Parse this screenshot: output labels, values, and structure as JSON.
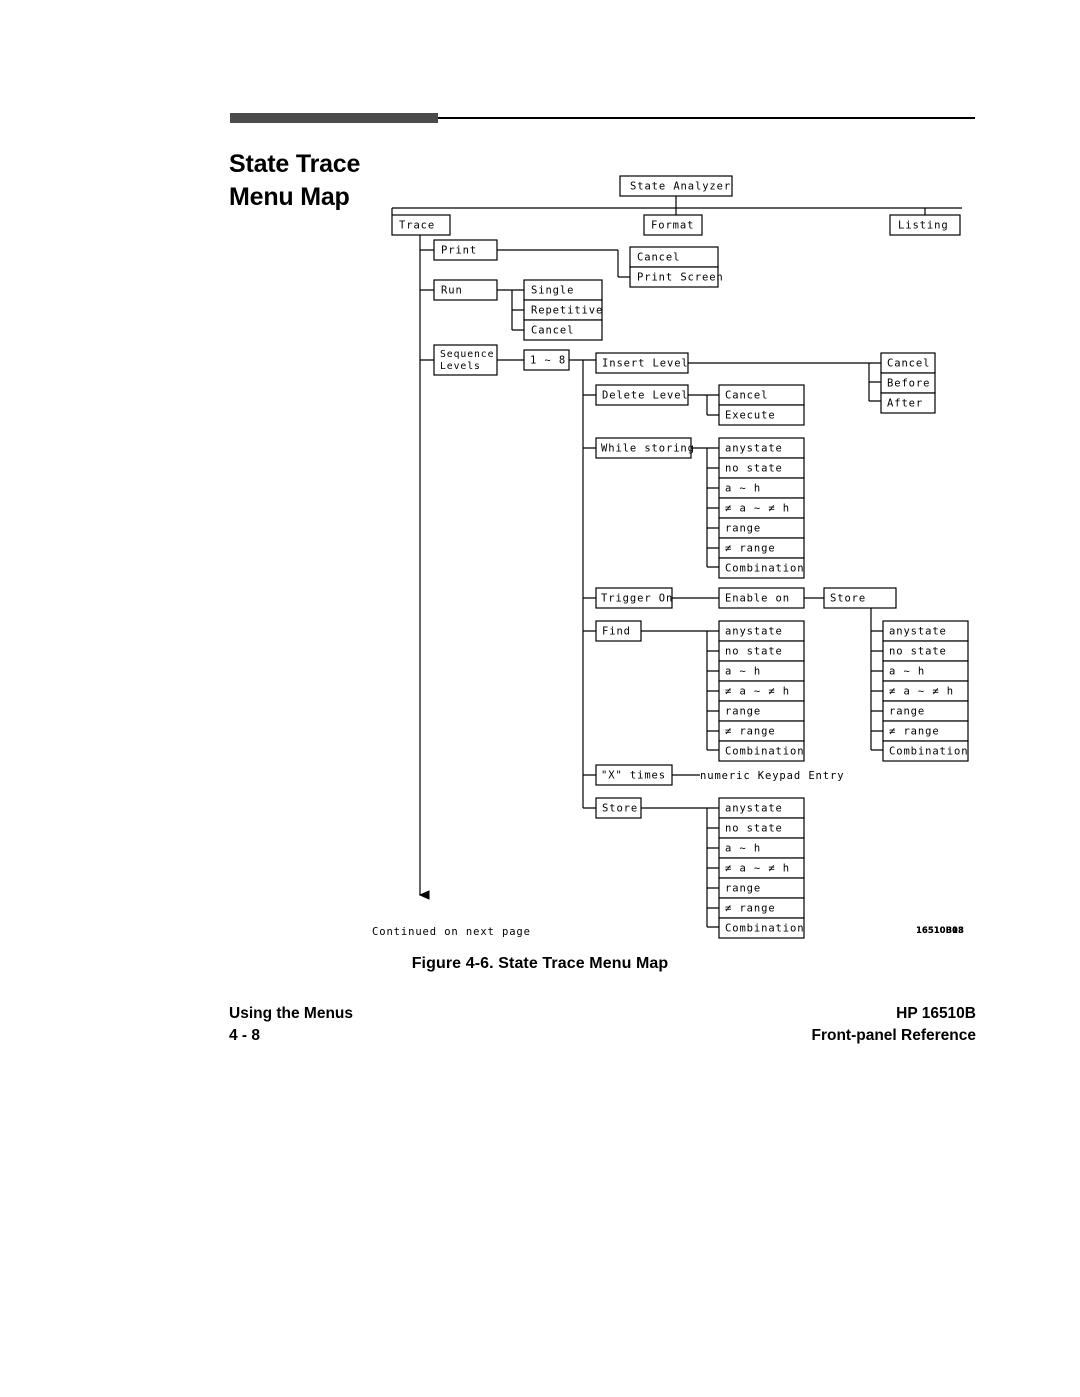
{
  "page": {
    "title_line1": "State Trace",
    "title_line2": "Menu Map",
    "figure_caption": "Figure 4-6. State Trace Menu Map",
    "part_number": "16510B08",
    "part_number_overlay": "16510B13",
    "continued_note": "Continued on next page"
  },
  "footer": {
    "left_top": "Using the Menus",
    "left_bottom": "4 - 8",
    "right_top": "HP 16510B",
    "right_bottom": "Front-panel Reference"
  },
  "colors": {
    "ink": "#000000",
    "rule": "#4b4b4b",
    "paper": "#ffffff"
  },
  "menu_map": {
    "root": "State Analyzer",
    "level1": [
      "Trace",
      "Format",
      "Listing"
    ],
    "trace_children": [
      "Print",
      "Run",
      "Sequence Levels"
    ],
    "print_children": [
      "Cancel",
      "Print Screen"
    ],
    "run_children": [
      "Single",
      "Repetitive",
      "Cancel"
    ],
    "sequence_range": "1 ~ 8",
    "sequence_children": [
      "Insert Level",
      "Delete Level",
      "While storing",
      "Trigger On",
      "Find",
      "\"X\" times",
      "Store"
    ],
    "insert_level_children": [
      "Cancel",
      "Before",
      "After"
    ],
    "delete_level_children": [
      "Cancel",
      "Execute"
    ],
    "while_storing_children": [
      "anystate",
      "no state",
      "a ~ h",
      "≠ a ~ ≠ h",
      "range",
      "≠ range",
      "Combination"
    ],
    "trigger_on_children": [
      "Enable on",
      "Store"
    ],
    "store_enable_children": [
      "anystate",
      "no state",
      "a ~ h",
      "≠ a ~ ≠ h",
      "range",
      "≠ range",
      "Combination"
    ],
    "find_children": [
      "anystate",
      "no state",
      "a ~ h",
      "≠ a ~ ≠ h",
      "range",
      "≠ range",
      "Combination"
    ],
    "x_times_children": [
      "numeric Keypad Entry"
    ],
    "store_children": [
      "anystate",
      "no state",
      "a ~ h",
      "≠ a ~ ≠ h",
      "range",
      "≠ range",
      "Combination"
    ]
  }
}
